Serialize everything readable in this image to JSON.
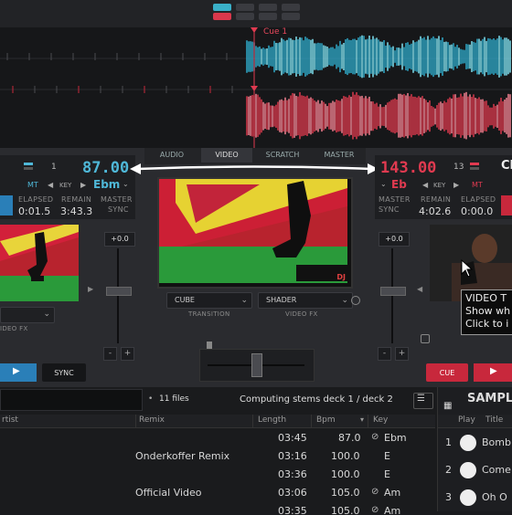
{
  "colors": {
    "accent_blue": "#4fb8d8",
    "accent_red": "#e03a50",
    "play_blue": "#2a7fb8",
    "cue_red": "#c8283c"
  },
  "waveform": {
    "cue_label": "Cue 1"
  },
  "deck_left": {
    "deck_number": "1",
    "bpm": "87.00",
    "mt": "MT",
    "key_label": "KEY",
    "key_value": "Ebm",
    "elapsed_label": "ELAPSED",
    "elapsed": "0:01.5",
    "remain_label": "REMAIN",
    "remain": "3:43.3",
    "master_label": "MASTER",
    "sync_label": "SYNC",
    "pitch": "+0.0",
    "sync_button": "SYNC",
    "fx_label": "IDEO FX"
  },
  "deck_right": {
    "deck_number": "13",
    "bpm": "143.00",
    "key_value": "Eb",
    "key_label": "KEY",
    "mt": "MT",
    "partial_title": "Cl",
    "master_label": "MASTER",
    "sync_label": "SYNC",
    "remain_label": "REMAIN",
    "remain": "4:02.6",
    "elapsed_label": "ELAPSED",
    "elapsed": "0:00.0",
    "pitch": "+0.0",
    "cue_button": "CUE",
    "tooltip": [
      "VIDEO T",
      "Show wh",
      "Click to i"
    ]
  },
  "center": {
    "tabs": [
      "AUDIO",
      "VIDEO",
      "SCRATCH",
      "MASTER"
    ],
    "transition_value": "CUBE",
    "transition_label": "TRANSITION",
    "shader_value": "SHADER",
    "videofx_label": "VIDEO FX",
    "video_watermark": "DJ"
  },
  "browser": {
    "file_count": "11 files",
    "status": "Computing stems deck 1 / deck 2",
    "columns": [
      "rtist",
      "Remix",
      "Length",
      "Bpm",
      "Key"
    ],
    "rows": [
      {
        "remix": "",
        "length": "03:45",
        "bpm": "87.0",
        "key": "Ebm",
        "icon": "check"
      },
      {
        "remix": "Onderkoffer Remix",
        "length": "03:16",
        "bpm": "100.0",
        "key": "E",
        "icon": ""
      },
      {
        "remix": "",
        "length": "03:36",
        "bpm": "100.0",
        "key": "E",
        "icon": ""
      },
      {
        "remix": "Official Video",
        "length": "03:06",
        "bpm": "105.0",
        "key": "Am",
        "icon": "check"
      },
      {
        "remix": "",
        "length": "03:35",
        "bpm": "105.0",
        "key": "Am",
        "icon": "check"
      }
    ]
  },
  "sampler": {
    "title": "SAMPL",
    "columns": [
      "Play",
      "Title"
    ],
    "rows": [
      {
        "num": "1",
        "title": "Bomb"
      },
      {
        "num": "2",
        "title": "Come"
      },
      {
        "num": "3",
        "title": "Oh O"
      }
    ]
  }
}
